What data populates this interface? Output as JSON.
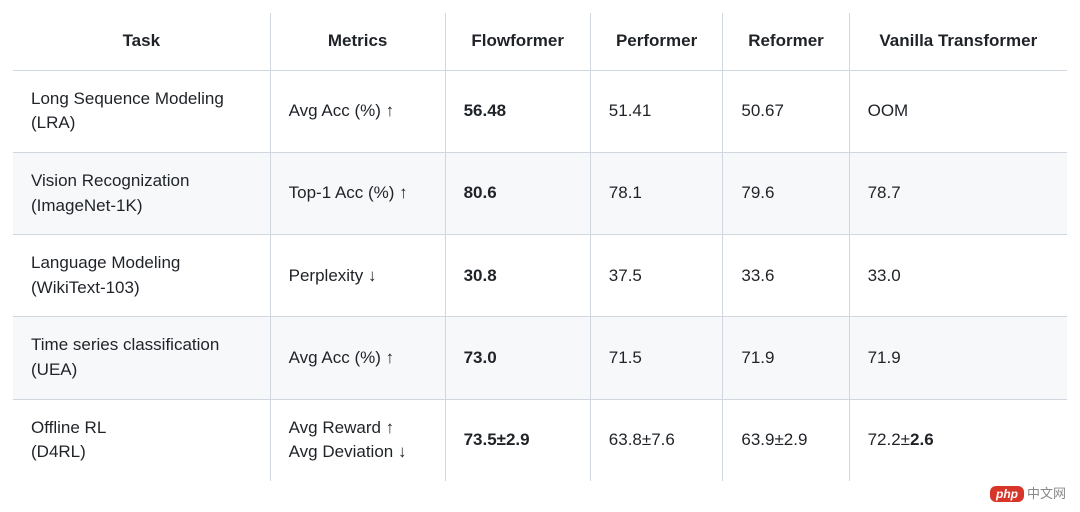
{
  "chart_data": {
    "type": "table",
    "columns": [
      "Task",
      "Metrics",
      "Flowformer",
      "Performer",
      "Reformer",
      "Vanilla Transformer"
    ],
    "rows": [
      {
        "task_l1": "Long Sequence Modeling",
        "task_l2": "(LRA)",
        "metric_l1": "Avg Acc (%) ↑",
        "metric_l2": "",
        "flowformer": "56.48",
        "performer": "51.41",
        "reformer": "50.67",
        "vanilla": "OOM",
        "bold_col": "flowformer"
      },
      {
        "task_l1": "Vision Recognization",
        "task_l2": "(ImageNet-1K)",
        "metric_l1": "Top-1 Acc (%) ↑",
        "metric_l2": "",
        "flowformer": "80.6",
        "performer": "78.1",
        "reformer": "79.6",
        "vanilla": "78.7",
        "bold_col": "flowformer"
      },
      {
        "task_l1": "Language Modeling",
        "task_l2": "(WikiText-103)",
        "metric_l1": "Perplexity ↓",
        "metric_l2": "",
        "flowformer": "30.8",
        "performer": "37.5",
        "reformer": "33.6",
        "vanilla": "33.0",
        "bold_col": "flowformer"
      },
      {
        "task_l1": "Time series classification",
        "task_l2": "(UEA)",
        "metric_l1": "Avg Acc (%) ↑",
        "metric_l2": "",
        "flowformer": "73.0",
        "performer": "71.5",
        "reformer": "71.9",
        "vanilla": "71.9",
        "bold_col": "flowformer"
      },
      {
        "task_l1": "Offline RL",
        "task_l2": "(D4RL)",
        "metric_l1": "Avg Reward ↑",
        "metric_l2": "Avg Deviation ↓",
        "flowformer": "73.5±2.9",
        "performer": "63.8±7.6",
        "reformer": "63.9±2.9",
        "vanilla": "72.2±2.6",
        "bold_col": "flowformer",
        "vanilla_bold_tail": "2.6"
      }
    ]
  },
  "watermark": {
    "pill": "php",
    "text": "中文网"
  }
}
